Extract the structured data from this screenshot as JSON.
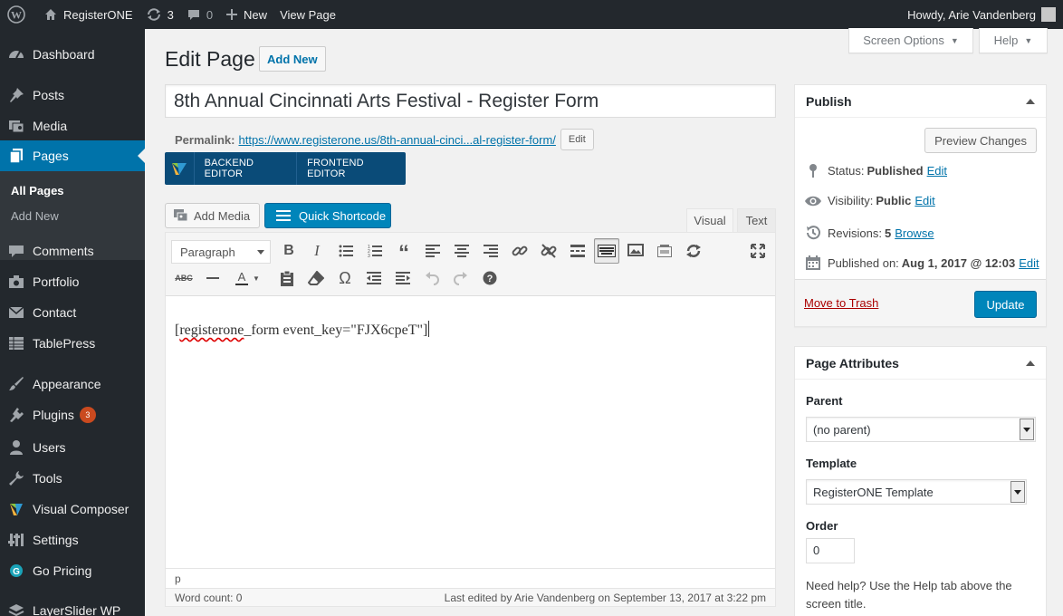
{
  "adminbar": {
    "site_name": "RegisterONE",
    "updates_count": "3",
    "comments_count": "0",
    "new_label": "New",
    "view_page_label": "View Page",
    "howdy": "Howdy, Arie Vandenberg"
  },
  "sidebar": {
    "items": [
      {
        "label": "Dashboard",
        "icon": "dashboard-icon"
      },
      {
        "label": "Posts",
        "icon": "pin-icon"
      },
      {
        "label": "Media",
        "icon": "media-icon"
      },
      {
        "label": "Pages",
        "icon": "pages-icon"
      },
      {
        "label": "Comments",
        "icon": "comment-icon"
      },
      {
        "label": "Portfolio",
        "icon": "camera-icon"
      },
      {
        "label": "Contact",
        "icon": "envelope-icon"
      },
      {
        "label": "TablePress",
        "icon": "table-icon"
      },
      {
        "label": "Appearance",
        "icon": "brush-icon"
      },
      {
        "label": "Plugins",
        "icon": "plug-icon",
        "badge": "3"
      },
      {
        "label": "Users",
        "icon": "user-icon"
      },
      {
        "label": "Tools",
        "icon": "wrench-icon"
      },
      {
        "label": "Visual Composer",
        "icon": "vc-icon"
      },
      {
        "label": "Settings",
        "icon": "settings-icon"
      },
      {
        "label": "Go Pricing",
        "icon": "gopricing-icon"
      },
      {
        "label": "LayerSlider WP",
        "icon": "layers-icon"
      }
    ],
    "submenu": [
      "All Pages",
      "Add New"
    ]
  },
  "screen_options": {
    "screen_options_label": "Screen Options",
    "help_label": "Help"
  },
  "page": {
    "title": "Edit Page",
    "add_new": "Add New",
    "post_title": "8th Annual Cincinnati Arts Festival - Register Form",
    "permalink_label": "Permalink:",
    "permalink_url": "https://www.registerone.us/8th-annual-cinci...al-register-form/",
    "permalink_edit": "Edit"
  },
  "vc": {
    "backend": "BACKEND EDITOR",
    "frontend": "FRONTEND EDITOR"
  },
  "editor": {
    "add_media": "Add Media",
    "quick_shortcode": "Quick Shortcode",
    "tab_visual": "Visual",
    "tab_text": "Text",
    "format_select": "Paragraph",
    "content_misspelled": "registerone",
    "content_open": "[",
    "content_rest": "_form event_key=\"FJX6cpeT\"]",
    "path": "p",
    "word_count": "Word count: 0",
    "last_edited": "Last edited by Arie Vandenberg on September 13, 2017 at 3:22 pm"
  },
  "publish": {
    "heading": "Publish",
    "preview": "Preview Changes",
    "status_label": "Status:",
    "status_value": "Published",
    "visibility_label": "Visibility:",
    "visibility_value": "Public",
    "revisions_label": "Revisions:",
    "revisions_value": "5",
    "browse": "Browse",
    "published_label": "Published on:",
    "published_value": "Aug 1, 2017 @ 12:03",
    "edit": "Edit",
    "trash": "Move to Trash",
    "update": "Update"
  },
  "attributes": {
    "heading": "Page Attributes",
    "parent_label": "Parent",
    "parent_value": "(no parent)",
    "template_label": "Template",
    "template_value": "RegisterONE Template",
    "order_label": "Order",
    "order_value": "0",
    "help": "Need help? Use the Help tab above the screen title."
  },
  "colors": {
    "accent": "#0073aa",
    "button_primary": "#0085ba",
    "sidebar": "#23282d",
    "vc_bar": "#0a4b78",
    "trash": "#aa0000"
  }
}
